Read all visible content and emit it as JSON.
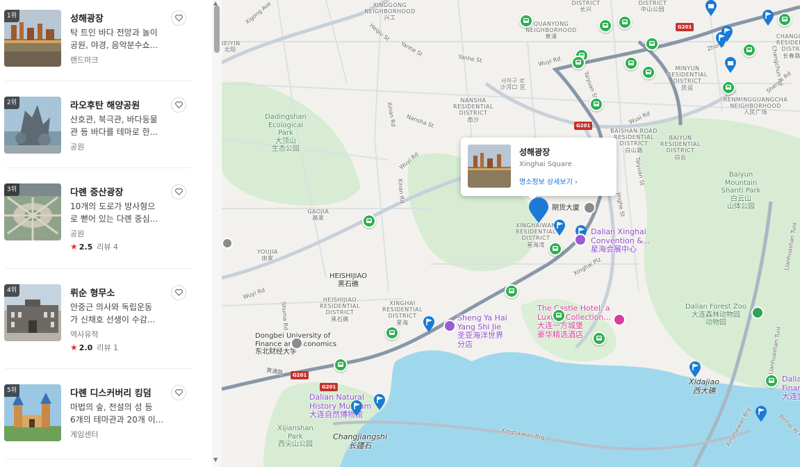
{
  "sidebar": {
    "items": [
      {
        "rank": "1위",
        "title": "성해광장",
        "desc1": "탁 트인 바다 전망과 놀이",
        "desc2": "공원, 야경, 음악분수쇼...",
        "category": "랜드마크"
      },
      {
        "rank": "2위",
        "title": "라오후탄 해양공원",
        "desc1": "산호관, 북극관, 바다동물",
        "desc2": "관 등 바다를 테마로 한...",
        "category": "공원"
      },
      {
        "rank": "3위",
        "title": "다롄 중산광장",
        "desc1": "10개의 도로가 방사형으",
        "desc2": "로 뻗어 있는 다롄 중심...",
        "category": "공원",
        "score": "2.5",
        "reviews": "리뷰 4"
      },
      {
        "rank": "4위",
        "title": "뤼순 형무소",
        "desc1": "안중근 의사와 독립운동",
        "desc2": "가 신채호 선생이 수감...",
        "category": "역사유적",
        "score": "2.0",
        "reviews": "리뷰 1"
      },
      {
        "rank": "5위",
        "title": "다롄 디스커버리 킹덤",
        "desc1": "마법의 숲, 전설의 성 등",
        "desc2": "6개의 테마관과 20개 이...",
        "category": "게임센터"
      }
    ],
    "icons": {
      "favorite": "heart-icon",
      "rating": "star-icon"
    }
  },
  "popup": {
    "title": "성해광장",
    "subtitle": "Xinghai Square",
    "link": "명소정보 상세보기 ›"
  },
  "map": {
    "districts": [
      {
        "id": "xinggong",
        "text": "XINGGONG\nNEIGHBORHOOD\n兴工"
      },
      {
        "id": "quanyong",
        "text": "QUANYONG\nNEIGHBORHOOD\n泉涌"
      },
      {
        "id": "nansha",
        "text": "NANSHA\nRESIDENTIAL\nDISTRICT\n南沙"
      },
      {
        "id": "minyun",
        "text": "MINYUN\nRESIDENTIAL\nDISTRICT\n民运"
      },
      {
        "id": "baishan",
        "text": "BAISHAN ROAD\nRESIDENTIAL\nDISTRICT\n白山路"
      },
      {
        "id": "baiyun",
        "text": "BAIYUN\nRESIDENTIAL\nDISTRICT\n白云"
      },
      {
        "id": "changchun",
        "text": "CHANGCH\nRESIDENT\nDISTRI\n长春路"
      },
      {
        "id": "renming",
        "text": "RENMINGGUANGCHA\nNEIGHBORHOOD\n人民广场"
      },
      {
        "id": "gaojia",
        "text": "GAOJIA\n高家"
      },
      {
        "id": "youjia",
        "text": "YOUJIA\n由家"
      },
      {
        "id": "heishijiao-rd",
        "text": "HEISHIJIAO\nRESIDENTIAL\nDISTRICT\n黑石礁"
      },
      {
        "id": "xinghai-rd",
        "text": "XINGHAI\nRESIDENTIAL\nDISTRICT\n星海"
      },
      {
        "id": "xinghaiwan",
        "text": "XINGHAIWAN\nRESIDENTIAL\nDISTRICT\n星海湾"
      },
      {
        "id": "district-top1",
        "text": "DISTRICT\n长兴"
      },
      {
        "id": "district-top2",
        "text": "DISTRICT\n中山公园"
      },
      {
        "id": "shacheng",
        "text": "사하구 로\n沙河口 区"
      }
    ],
    "roads": [
      "Xigong Ave",
      "Heqiu St",
      "Yanhe St",
      "Yanhe St",
      "Wuyi Rd",
      "Taiyuan St",
      "Wusi Rd",
      "Xinan Rd",
      "Nansha St",
      "Wuyi Rd",
      "Xinan Rd",
      "Taiyuan St",
      "Xinghai Plz",
      "Wuyi Rd",
      "Shuma Rd",
      "Zhong",
      "Shengli Rd",
      "Lianhuashan Tunl",
      "Lianhuashan Tunl",
      "Xinghaiwan Brg",
      "Xinghaiwan Brg",
      "Binhai W Rd",
      "Changchun Rd",
      "Jinghe St",
      "黄浦路"
    ],
    "parks": [
      {
        "id": "dadingshan",
        "text": "Dadingshan\nEcological\nPark\n大顶山\n生态公园"
      },
      {
        "id": "baiyun-park",
        "text": "Baiyun\nMountain\nShanti Park\n白云山\n山体公园"
      },
      {
        "id": "forest-zoo",
        "text": "Dalian Forest Zoo\n大连森林动物园\n动物园"
      },
      {
        "id": "xijianshan",
        "text": "Xijianshan\nPark\n西尖山公园"
      }
    ],
    "places": [
      {
        "id": "heishijiao",
        "text": "HEISHIJIAO\n黑石礁"
      },
      {
        "id": "xidajiao",
        "text": "Xidajiao\n西大礁"
      },
      {
        "id": "changjiangshi",
        "text": "Changjiangshi\n长疆石"
      },
      {
        "id": "beiyin",
        "text": "BEIYIN\n北阳"
      },
      {
        "id": "qihuo",
        "text": "期货大厦"
      }
    ],
    "pois": [
      {
        "id": "convention",
        "color": "purple",
        "text": "Dalian Xinghai\nConvention &...\n星海会展中心"
      },
      {
        "id": "shengyahai",
        "text": "Sheng Ya Hai\nYang Shi Jie\n圣亚海洋世界\n分店",
        "color": "purple"
      },
      {
        "id": "castle",
        "text": "The Castle Hotel, a\nLuxury Collection...\n大连一方城堡\n豪华精选酒店",
        "color": "pink"
      },
      {
        "id": "museum",
        "text": "Dalian Natural\nHistory Museum\n大连自然博物馆",
        "color": "purple"
      },
      {
        "id": "dongbei",
        "text": "Dongbei University of\nFinance and Economics\n东北财经大学",
        "color": "dark"
      },
      {
        "id": "dalian-fin",
        "text": "Dalia\nFinan\n大连金",
        "color": "purple"
      }
    ],
    "road_shields": [
      "G201",
      "G201",
      "G201",
      "G201"
    ]
  },
  "colors": {
    "land": "#f3f1ed",
    "park": "#cdeacc",
    "water": "#9fd8ec",
    "road": "#c7d0da",
    "major_road": "#8896a8",
    "green_pin": "#2bb04f",
    "blue_pin": "#1a7ad6",
    "accent": "#e5302d"
  }
}
